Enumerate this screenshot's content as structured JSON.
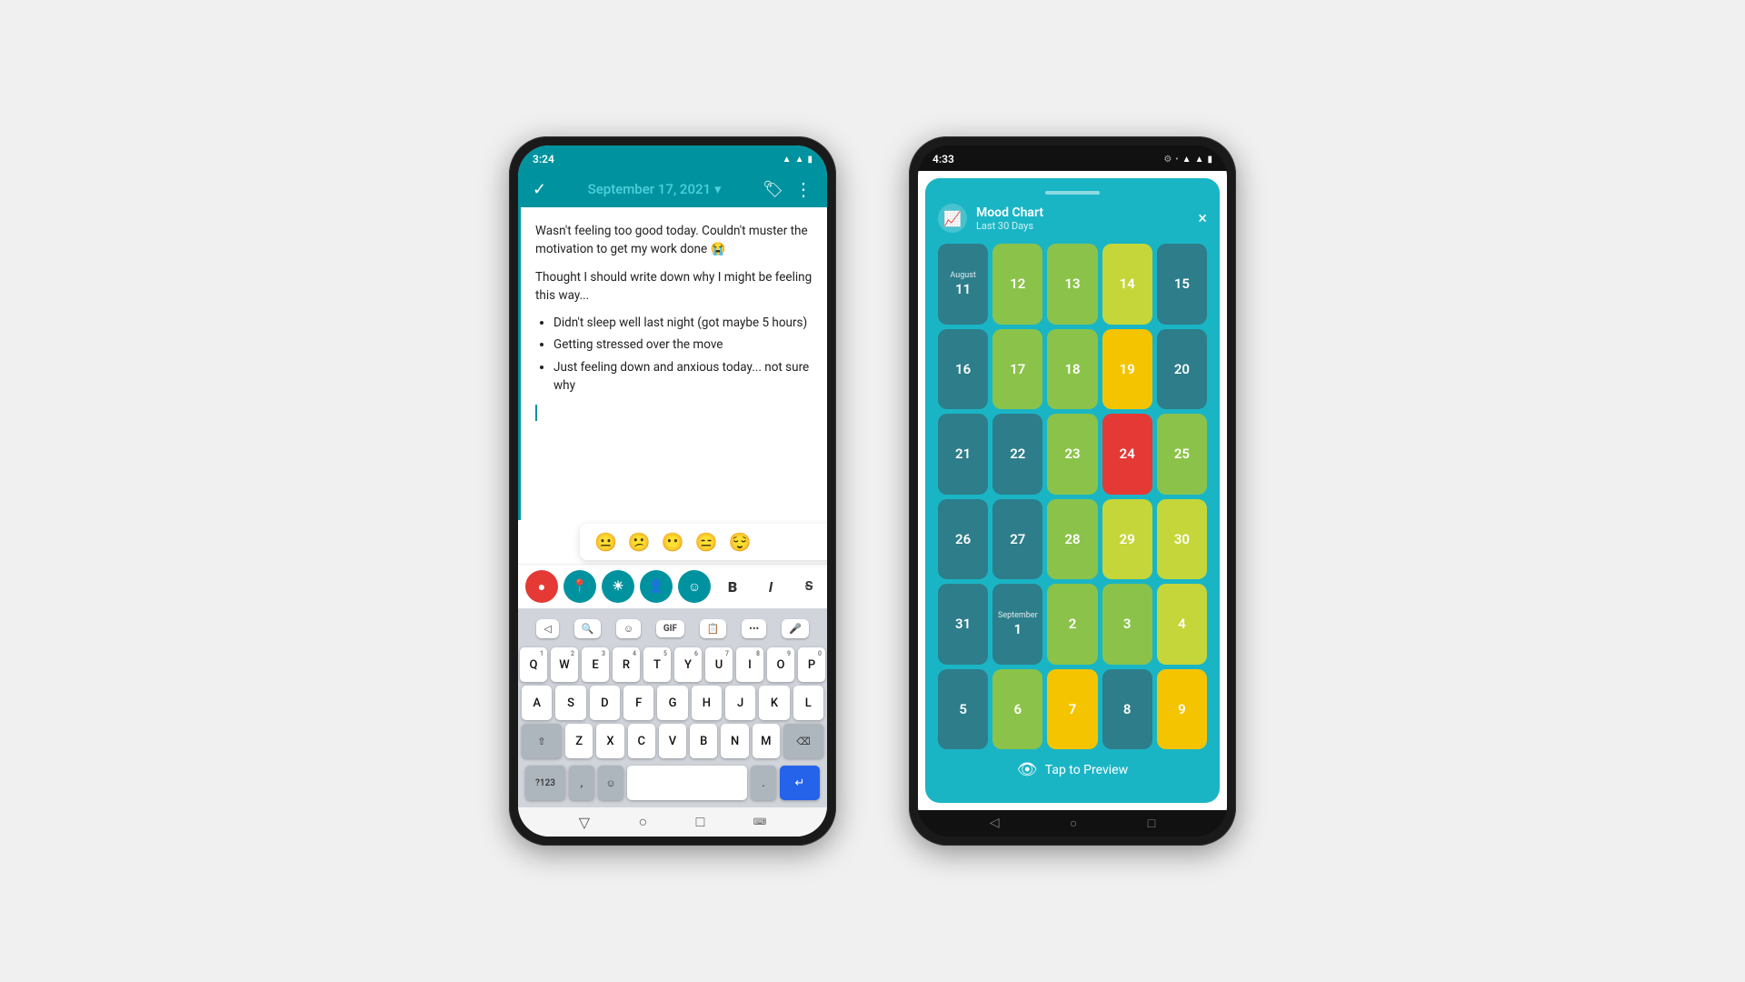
{
  "phone1": {
    "status_time": "3:24",
    "toolbar": {
      "check_icon": "✓",
      "date": "September 17, 2021",
      "date_arrow": "▾",
      "tag_icon": "⊘",
      "more_icon": "⋮"
    },
    "journal": {
      "paragraph1": "Wasn't feeling too good today. Couldn't muster the motivation to get my work done 😭",
      "paragraph2": "Thought I should write down why I might be feeling this way...",
      "bullet1": "Didn't sleep well last night (got maybe 5 hours)",
      "bullet2": "Getting stressed over the move",
      "bullet3": "Just feeling down and anxious today... not sure why"
    },
    "emojis": [
      "😐",
      "😕",
      "😶",
      "😑",
      "😌"
    ],
    "format_buttons": [
      "B",
      "I",
      "S"
    ],
    "keyboard": {
      "row1": [
        "Q",
        "W",
        "E",
        "R",
        "T",
        "Y",
        "U",
        "I",
        "O",
        "P"
      ],
      "row1_nums": [
        "1",
        "2",
        "3",
        "4",
        "5",
        "6",
        "7",
        "8",
        "9",
        "0"
      ],
      "row2": [
        "A",
        "S",
        "D",
        "F",
        "G",
        "H",
        "J",
        "K",
        "L"
      ],
      "row3": [
        "Z",
        "X",
        "C",
        "V",
        "B",
        "N",
        "M"
      ],
      "special_label": "?123",
      "comma": ",",
      "emoji_key": "☺",
      "period": ".",
      "enter_icon": "⏎",
      "back_icon": "⌫"
    }
  },
  "phone2": {
    "status_time": "4:33",
    "mood_chart": {
      "title": "Mood Chart",
      "subtitle": "Last 30 Days",
      "close": "×",
      "tap_preview": "Tap to Preview",
      "grid": [
        [
          {
            "label": "August\n11",
            "color": "teal"
          },
          {
            "label": "12",
            "color": "green"
          },
          {
            "label": "13",
            "color": "green"
          },
          {
            "label": "14",
            "color": "yellow-green"
          },
          {
            "label": "15",
            "color": "teal"
          }
        ],
        [
          {
            "label": "16",
            "color": "teal"
          },
          {
            "label": "17",
            "color": "green"
          },
          {
            "label": "18",
            "color": "green"
          },
          {
            "label": "19",
            "color": "yellow"
          },
          {
            "label": "20",
            "color": "teal"
          }
        ],
        [
          {
            "label": "21",
            "color": "teal"
          },
          {
            "label": "22",
            "color": "teal"
          },
          {
            "label": "23",
            "color": "green"
          },
          {
            "label": "24",
            "color": "red"
          },
          {
            "label": "25",
            "color": "green"
          }
        ],
        [
          {
            "label": "26",
            "color": "teal"
          },
          {
            "label": "27",
            "color": "teal"
          },
          {
            "label": "28",
            "color": "green"
          },
          {
            "label": "29",
            "color": "yellow-green"
          },
          {
            "label": "30",
            "color": "yellow-green"
          }
        ],
        [
          {
            "label": "31",
            "color": "teal"
          },
          {
            "label": "September\n1",
            "color": "teal"
          },
          {
            "label": "2",
            "color": "green"
          },
          {
            "label": "3",
            "color": "green"
          },
          {
            "label": "4",
            "color": "yellow-green"
          }
        ],
        [
          {
            "label": "5",
            "color": "teal"
          },
          {
            "label": "6",
            "color": "green"
          },
          {
            "label": "7",
            "color": "yellow"
          },
          {
            "label": "8",
            "color": "teal"
          },
          {
            "label": "9",
            "color": "yellow"
          }
        ]
      ]
    }
  }
}
